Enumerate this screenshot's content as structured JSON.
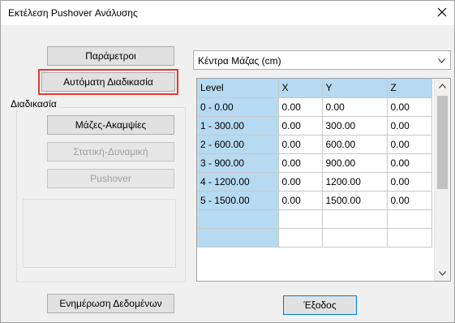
{
  "window": {
    "title": "Εκτέλεση Pushover Ανάλυσης",
    "close_icon": "close-icon"
  },
  "left": {
    "parameters_label": "Παράμετροι",
    "auto_procedure_label": "Αυτόματη Διαδικασία",
    "procedure_group_label": "Διαδικασία",
    "masses_stiffness_label": "Μάζες-Ακαμψίες",
    "static_dynamic_label": "Στατική-Δυναμική",
    "pushover_label": "Pushover",
    "update_data_label": "Ενημέρωση Δεδομένων"
  },
  "right": {
    "combo_value": "Κέντρα Μάζας (cm)",
    "table": {
      "headers": [
        "Level",
        "X",
        "Y",
        "Z"
      ],
      "rows": [
        [
          "0 - 0.00",
          "0.00",
          "0.00",
          "0.00"
        ],
        [
          "1 - 300.00",
          "0.00",
          "300.00",
          "0.00"
        ],
        [
          "2 - 600.00",
          "0.00",
          "600.00",
          "0.00"
        ],
        [
          "3 - 900.00",
          "0.00",
          "900.00",
          "0.00"
        ],
        [
          "4 - 1200.00",
          "0.00",
          "1200.00",
          "0.00"
        ],
        [
          "5 - 1500.00",
          "0.00",
          "1500.00",
          "0.00"
        ],
        [
          "",
          "",
          "",
          ""
        ],
        [
          "",
          "",
          "",
          ""
        ]
      ]
    }
  },
  "footer": {
    "exit_label": "Έξοδος"
  },
  "colors": {
    "header_bg": "#b6daf1",
    "highlight_border": "#e53935",
    "focus_border": "#0078d7"
  }
}
